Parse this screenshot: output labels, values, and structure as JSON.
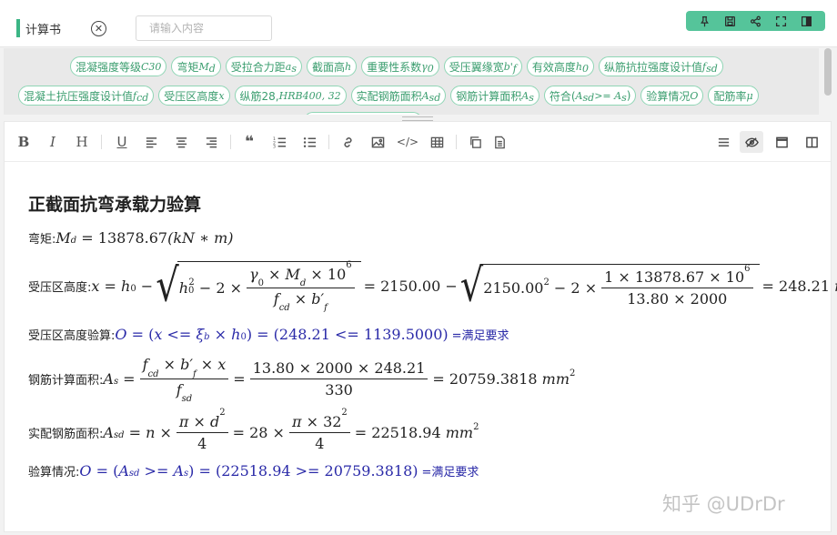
{
  "header": {
    "title": "计算书",
    "search_placeholder": "请输入内容",
    "search_value": ""
  },
  "variables_row1": [
    {
      "text": "混凝强度等级",
      "sym": "C30"
    },
    {
      "text": "弯矩",
      "sym": "M",
      "sub": "d"
    },
    {
      "text": "受拉合力距",
      "sym": "a",
      "sub": "s"
    },
    {
      "text": "截面高",
      "sym": "h"
    },
    {
      "text": "重要性系数",
      "sym": "γ",
      "sub": "0"
    },
    {
      "text": "受压翼缘宽",
      "sym": "b'",
      "sub": "f"
    },
    {
      "text": "有效高度",
      "sym": "h",
      "sub": "0"
    },
    {
      "text": "纵筋抗拉强度设计值",
      "sym": "f",
      "sub": "sd"
    }
  ],
  "variables_row2": [
    {
      "text": "混凝土抗压强度设计值",
      "sym": "f",
      "sub": "cd"
    },
    {
      "text": "受压区高度",
      "sym": "x"
    },
    {
      "text": "纵筋28, ",
      "sym": "HRB400, 32"
    },
    {
      "text": "实配钢筋面积",
      "sym": "A",
      "sub": "sd"
    },
    {
      "text": "钢筋计算面积",
      "sym": "A",
      "sub": "s"
    },
    {
      "text": "符合(",
      "sym": "A",
      "sub": "sd",
      "tail": " >= A",
      "tail_sub": "s",
      "close": ")"
    },
    {
      "text": "验算情况",
      "sym": "O"
    },
    {
      "text": "配筋率",
      "sym": "μ"
    }
  ],
  "doc": {
    "heading": "正截面抗弯承载力验算",
    "moment_label": "弯矩:",
    "moment_value": "13878.67",
    "moment_unit": "(kN ∗ m)",
    "x_label": "受压区高度:",
    "x_h0_val": "2150.00",
    "x_h0_sq": "2150.00",
    "x_num_val": "1 × 13878.67 × 10",
    "x_num_exp": "6",
    "x_den_val": "13.80 × 2000",
    "x_result": "248.21",
    "x_unit": "mm",
    "check_label": "受压区高度验算:",
    "check_expr": "(248.21 <= 1139.5000)",
    "check_ok": "=满足要求",
    "as_label": "钢筋计算面积:",
    "as_num_val": "13.80 × 2000 × 248.21",
    "as_den_val": "330",
    "as_result": "20759.3818",
    "asd_label": "实配钢筋面积:",
    "asd_n": "28",
    "asd_d": "32",
    "asd_result": "22518.94",
    "verify_label": "验算情况:",
    "verify_expr": "(22518.94 >= 20759.3818)",
    "verify_ok": "=满足要求"
  },
  "watermark": "知乎 @UDrDr",
  "colors": {
    "accent": "#3bb585",
    "chip_text": "#3a9d6e",
    "math_blue": "#2a2aa8"
  }
}
